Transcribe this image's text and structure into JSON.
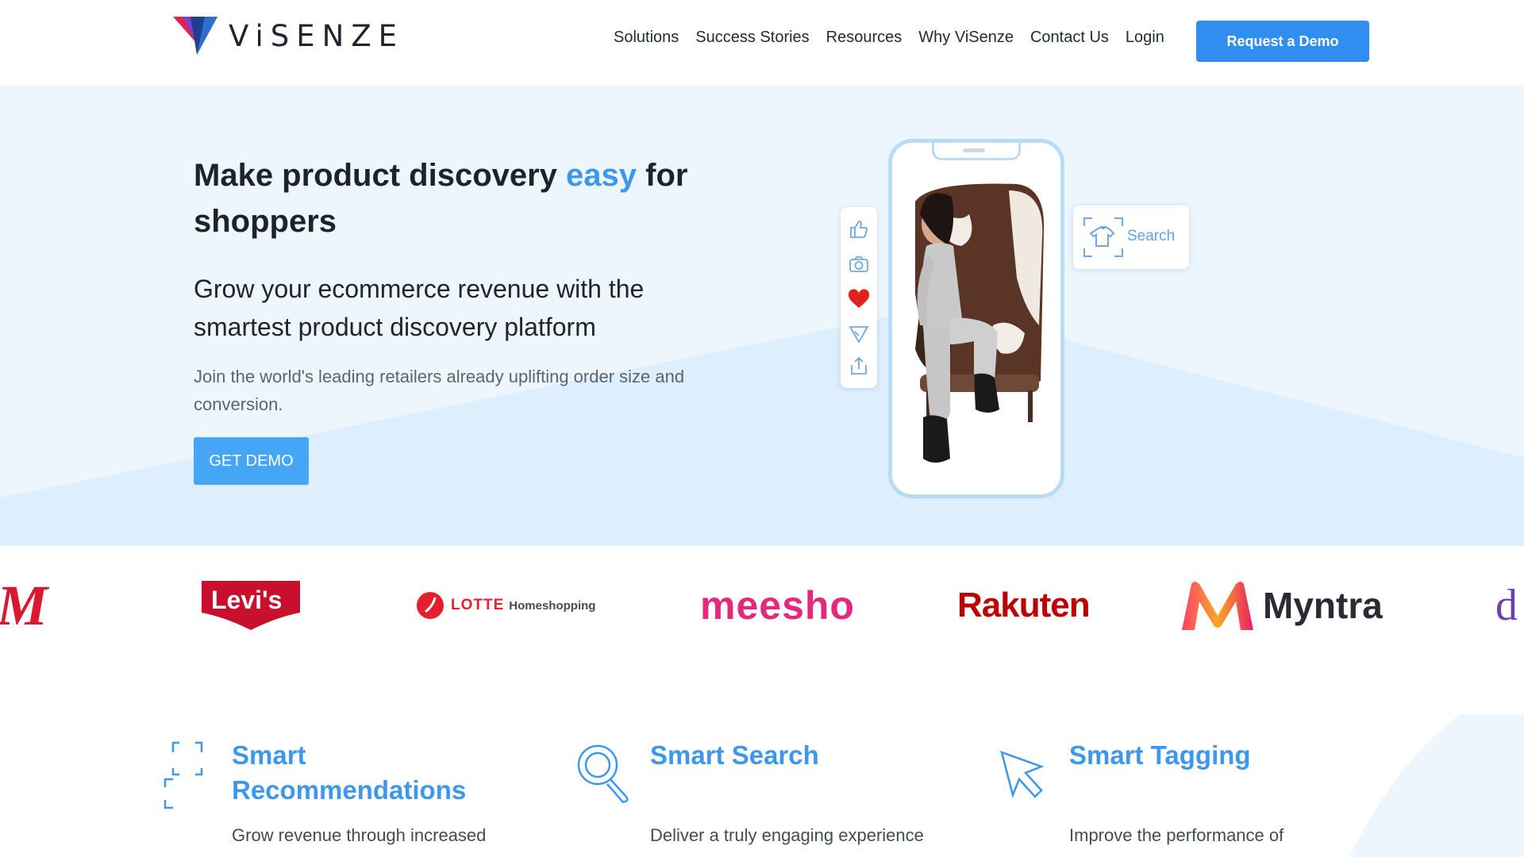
{
  "header": {
    "logo_text": "ViSENZE",
    "nav": [
      "Solutions",
      "Success Stories",
      "Resources",
      "Why ViSenze",
      "Contact Us",
      "Login"
    ],
    "cta": "Request a Demo"
  },
  "hero": {
    "title_pre": "Make product discovery ",
    "title_accent": "easy",
    "title_post": " for shoppers",
    "subtitle": "Grow your ecommerce revenue with the smartest product discovery platform",
    "note": "Join the world's leading retailers already uplifting order size and conversion.",
    "cta": "GET DEMO",
    "search_label": "Search",
    "colors": {
      "accent": "#3d97ec",
      "button": "#45a6f5",
      "heart": "#e0231f"
    },
    "action_icons": [
      "thumbs-up-icon",
      "camera-icon",
      "heart-icon",
      "send-icon",
      "share-icon"
    ]
  },
  "logos": {
    "partial_left": "M",
    "levis": "Levi's",
    "lotte_main": "LOTTE",
    "lotte_sub": "Homeshopping",
    "meesho": "meesho",
    "rakuten": "Rakuten",
    "myntra": "Myntra",
    "partial_right": "d"
  },
  "features": [
    {
      "icon": "frame-icon",
      "title": "Smart Recommendations",
      "desc": "Grow revenue through increased"
    },
    {
      "icon": "magnifier-icon",
      "title": "Smart Search",
      "desc": "Deliver a truly engaging experience"
    },
    {
      "icon": "cursor-icon",
      "title": "Smart Tagging",
      "desc": "Improve the performance of"
    }
  ]
}
